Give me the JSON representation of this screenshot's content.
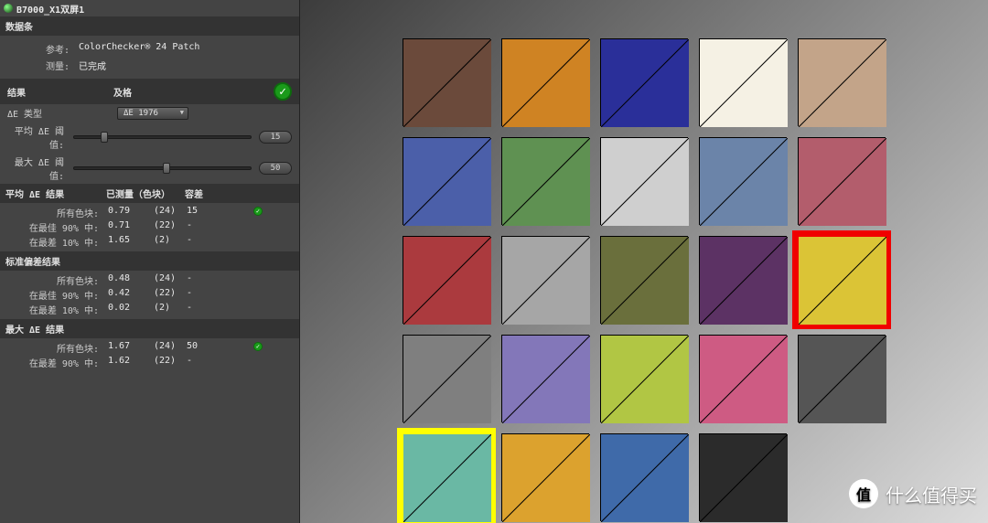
{
  "titlebar": {
    "title": "B7000_X1双屏1"
  },
  "sections": {
    "data": {
      "header": "数据条"
    },
    "result": {
      "header": "结果"
    },
    "avg": {
      "header": "平均 ΔE 结果"
    },
    "std": {
      "header": "标准偏差结果"
    },
    "max": {
      "header": "最大 ΔE 结果"
    }
  },
  "meta": {
    "ref_label": "参考:",
    "ref_value": "ColorChecker® 24 Patch",
    "measure_label": "测量:",
    "measure_value": "已完成"
  },
  "result": {
    "status_value": "及格",
    "delta_type_label": "ΔE 类型",
    "delta_type_value": "ΔE 1976",
    "avg_threshold_label": "平均 ΔE 阈值:",
    "avg_threshold_value": "15",
    "avg_slider_pct": 15,
    "max_threshold_label": "最大 ΔE 阈值:",
    "max_threshold_value": "50",
    "max_slider_pct": 50
  },
  "columns": {
    "col_measured": "已测量（色块）",
    "col_tolerance": "容差"
  },
  "avg_rows": [
    {
      "label": "所有色块:",
      "val": "0.79",
      "count": "(24)",
      "tol": "15",
      "ok": true
    },
    {
      "label": "在最佳 90% 中:",
      "val": "0.71",
      "count": "(22)",
      "tol": "-",
      "ok": false
    },
    {
      "label": "在最差 10% 中:",
      "val": "1.65",
      "count": "(2)",
      "tol": "-",
      "ok": false
    }
  ],
  "std_rows": [
    {
      "label": "所有色块:",
      "val": "0.48",
      "count": "(24)",
      "tol": "-",
      "ok": false
    },
    {
      "label": "在最佳 90% 中:",
      "val": "0.42",
      "count": "(22)",
      "tol": "-",
      "ok": false
    },
    {
      "label": "在最差 10% 中:",
      "val": "0.02",
      "count": "(2)",
      "tol": "-",
      "ok": false
    }
  ],
  "max_rows": [
    {
      "label": "所有色块:",
      "val": "1.67",
      "count": "(24)",
      "tol": "50",
      "ok": true
    },
    {
      "label": "在最差 90% 中:",
      "val": "1.62",
      "count": "(22)",
      "tol": "-",
      "ok": false
    }
  ],
  "swatches": [
    {
      "c1": "#6b4a3b",
      "c2": "#6b4a3b",
      "hl": ""
    },
    {
      "c1": "#cf8323",
      "c2": "#cf8323",
      "hl": ""
    },
    {
      "c1": "#2a2f99",
      "c2": "#2a2f99",
      "hl": ""
    },
    {
      "c1": "#f5f1e4",
      "c2": "#f5f1e4",
      "hl": ""
    },
    {
      "c1": "#c3a489",
      "c2": "#c3a489",
      "hl": ""
    },
    {
      "c1": "#4b5fa9",
      "c2": "#4b5fa9",
      "hl": ""
    },
    {
      "c1": "#5f9152",
      "c2": "#5f9152",
      "hl": ""
    },
    {
      "c1": "#cfcfcf",
      "c2": "#cfcfcf",
      "hl": ""
    },
    {
      "c1": "#6b84a9",
      "c2": "#6b84a9",
      "hl": ""
    },
    {
      "c1": "#b35d6c",
      "c2": "#b35d6c",
      "hl": ""
    },
    {
      "c1": "#ab3a3e",
      "c2": "#ab3a3e",
      "hl": ""
    },
    {
      "c1": "#a6a6a6",
      "c2": "#a6a6a6",
      "hl": ""
    },
    {
      "c1": "#6a6f3c",
      "c2": "#6a6f3c",
      "hl": ""
    },
    {
      "c1": "#5c3264",
      "c2": "#5c3264",
      "hl": ""
    },
    {
      "c1": "#dbc436",
      "c2": "#dbc436",
      "hl": "red"
    },
    {
      "c1": "#7f7f7f",
      "c2": "#7f7f7f",
      "hl": ""
    },
    {
      "c1": "#8377b9",
      "c2": "#8377b9",
      "hl": ""
    },
    {
      "c1": "#b1c644",
      "c2": "#b1c644",
      "hl": ""
    },
    {
      "c1": "#ce5b83",
      "c2": "#ce5b83",
      "hl": ""
    },
    {
      "c1": "#555555",
      "c2": "#555555",
      "hl": ""
    },
    {
      "c1": "#6ab8a4",
      "c2": "#6ab8a4",
      "hl": "yellow"
    },
    {
      "c1": "#dca22e",
      "c2": "#dca22e",
      "hl": ""
    },
    {
      "c1": "#3f6aa9",
      "c2": "#3f6aa9",
      "hl": ""
    },
    {
      "c1": "#2b2b2b",
      "c2": "#2b2b2b",
      "hl": ""
    }
  ],
  "watermark": {
    "badge": "值",
    "text": "什么值得买"
  }
}
